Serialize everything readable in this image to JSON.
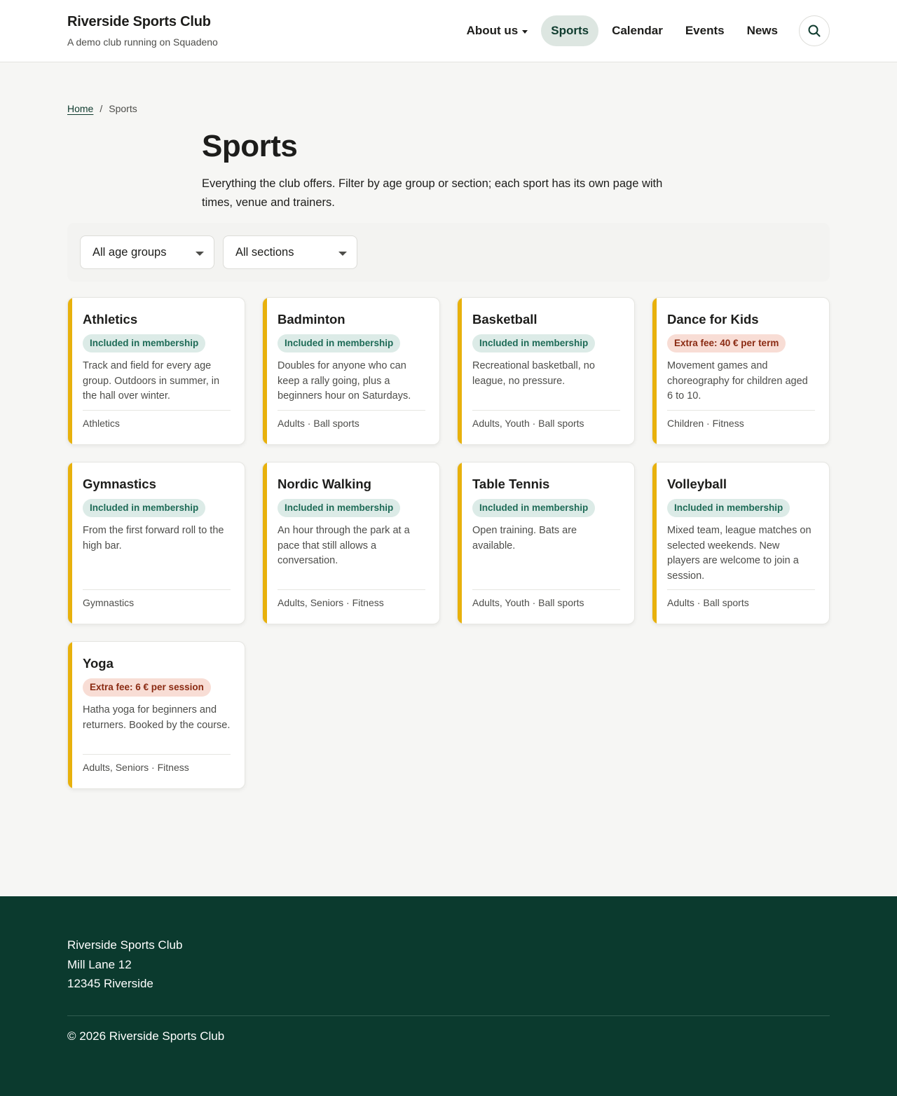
{
  "header": {
    "title": "Riverside Sports Club",
    "subtitle": "A demo club running on Squadeno",
    "nav": {
      "about": "About us",
      "sports": "Sports",
      "calendar": "Calendar",
      "events": "Events",
      "news": "News"
    },
    "search_icon": "search-icon"
  },
  "breadcrumb": {
    "home": "Home",
    "separator": "/",
    "current": "Sports"
  },
  "page": {
    "title": "Sports",
    "intro": "Everything the club offers. Filter by age group or section; each sport has its own page with times, venue and trainers."
  },
  "filters": {
    "age_group": "All age groups",
    "section": "All sections"
  },
  "colors": {
    "accent_bar": "#e8b10c",
    "footer_bg": "#0b3a2e",
    "included_badge_bg": "#dcebe7",
    "fee_badge_bg": "#f8ddd5"
  },
  "sports": [
    {
      "name": "Athletics",
      "badge": "Included in membership",
      "badge_type": "included",
      "desc": "Track and field for every age group. Outdoors in summer, in the hall over winter.",
      "meta": "Athletics"
    },
    {
      "name": "Badminton",
      "badge": "Included in membership",
      "badge_type": "included",
      "desc": "Doubles for anyone who can keep a rally going, plus a beginners hour on Saturdays.",
      "meta": "Adults · Ball sports"
    },
    {
      "name": "Basketball",
      "badge": "Included in membership",
      "badge_type": "included",
      "desc": "Recreational basketball, no league, no pressure.",
      "meta": "Adults, Youth · Ball sports"
    },
    {
      "name": "Dance for Kids",
      "badge": "Extra fee: 40 € per term",
      "badge_type": "fee",
      "desc": "Movement games and choreography for children aged 6 to 10.",
      "meta": "Children · Fitness"
    },
    {
      "name": "Gymnastics",
      "badge": "Included in membership",
      "badge_type": "included",
      "desc": "From the first forward roll to the high bar.",
      "meta": "Gymnastics"
    },
    {
      "name": "Nordic Walking",
      "badge": "Included in membership",
      "badge_type": "included",
      "desc": "An hour through the park at a pace that still allows a conversation.",
      "meta": "Adults, Seniors · Fitness"
    },
    {
      "name": "Table Tennis",
      "badge": "Included in membership",
      "badge_type": "included",
      "desc": "Open training. Bats are available.",
      "meta": "Adults, Youth · Ball sports"
    },
    {
      "name": "Volleyball",
      "badge": "Included in membership",
      "badge_type": "included",
      "desc": "Mixed team, league matches on selected weekends. New players are welcome to join a session.",
      "meta": "Adults · Ball sports"
    },
    {
      "name": "Yoga",
      "badge": "Extra fee: 6 € per session",
      "badge_type": "fee",
      "desc": "Hatha yoga for beginners and returners. Booked by the course.",
      "meta": "Adults, Seniors · Fitness"
    }
  ],
  "footer": {
    "address_line1": "Riverside Sports Club",
    "address_line2": "Mill Lane 12",
    "address_line3": "12345 Riverside",
    "copyright": "© 2026 Riverside Sports Club"
  }
}
